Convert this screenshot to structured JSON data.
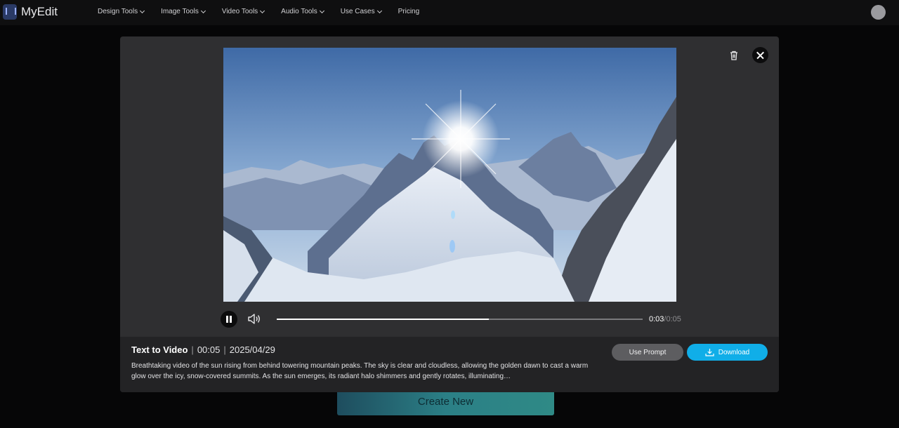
{
  "app": {
    "logo_text": "MyEdit"
  },
  "nav": {
    "items": [
      {
        "label": "Design Tools"
      },
      {
        "label": "Image Tools"
      },
      {
        "label": "Video Tools"
      },
      {
        "label": "Audio Tools"
      },
      {
        "label": "Use Cases"
      },
      {
        "label": "Pricing"
      }
    ]
  },
  "background": {
    "create_new_label": "Create New"
  },
  "modal": {
    "player": {
      "current_time": "0:03",
      "total_time": "/0:05",
      "progress": 0.58
    },
    "info": {
      "title": "Text to Video",
      "separator": "|",
      "duration": "00:05",
      "date": "2025/04/29",
      "description": "Breathtaking video of the sun rising from behind towering mountain peaks. The sky is clear and cloudless, allowing the golden dawn to cast a warm glow over the icy, snow-covered summits. As the sun emerges, its radiant halo shimmers and gently rotates, illuminating…",
      "use_prompt_label": "Use Prompt",
      "download_label": "Download"
    }
  },
  "colors": {
    "accent": "#10aee8",
    "modal_bg": "#2f2f31",
    "info_bg": "#232325"
  },
  "icons": {
    "trash": "trash-icon",
    "close": "close-icon",
    "pause": "pause-icon",
    "volume": "volume-icon",
    "download": "download-icon",
    "chevron": "chevron-down-icon"
  }
}
